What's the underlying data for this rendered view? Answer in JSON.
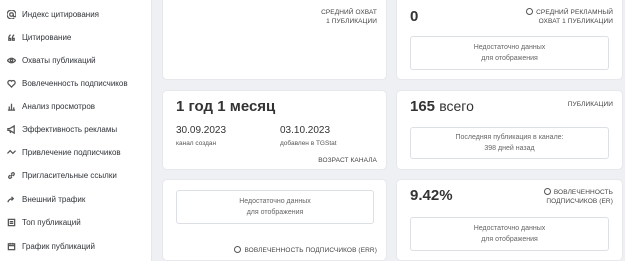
{
  "sidebar": {
    "items": [
      {
        "label": "Индекс цитирования",
        "icon": "at-icon"
      },
      {
        "label": "Цитирование",
        "icon": "quote-icon"
      },
      {
        "label": "Охваты публикаций",
        "icon": "eye-icon"
      },
      {
        "label": "Вовлеченность подписчиков",
        "icon": "heart-icon"
      },
      {
        "label": "Анализ просмотров",
        "icon": "bar-chart-icon"
      },
      {
        "label": "Эффективность рекламы",
        "icon": "megaphone-icon"
      },
      {
        "label": "Привлечение подписчиков",
        "icon": "trend-icon"
      },
      {
        "label": "Пригласительные ссылки",
        "icon": "link-icon"
      },
      {
        "label": "Внешний трафик",
        "icon": "share-icon"
      },
      {
        "label": "Топ публикаций",
        "icon": "list-icon"
      },
      {
        "label": "График публикаций",
        "icon": "calendar-icon"
      }
    ]
  },
  "cards": {
    "reach": {
      "label_line1": "СРЕДНИЙ ОХВАТ",
      "label_line2": "1 ПУБЛИКАЦИИ"
    },
    "ad_reach": {
      "value": "0",
      "label_line1": "СРЕДНИЙ РЕКЛАМНЫЙ",
      "label_line2": "ОХВАТ 1 ПУБЛИКАЦИИ",
      "empty_line1": "Недостаточно данных",
      "empty_line2": "для отображения"
    },
    "age": {
      "value": "1 год 1 месяц",
      "created_date": "30.09.2023",
      "created_label": "канал создан",
      "added_date": "03.10.2023",
      "added_label": "добавлен в TGStat",
      "footer": "ВОЗРАСТ КАНАЛА"
    },
    "posts": {
      "value": "165",
      "unit": "всего",
      "label": "ПУБЛИКАЦИИ",
      "last_line1": "Последняя публикация в канале:",
      "last_line2": "398 дней назад"
    },
    "err": {
      "empty_line1": "Недостаточно данных",
      "empty_line2": "для отображения",
      "footer": "ВОВЛЕЧЕННОСТЬ ПОДПИСЧИКОВ (ERR)"
    },
    "er": {
      "value": "9.42%",
      "label_line1": "ВОВЛЕЧЕННОСТЬ",
      "label_line2": "ПОДПИСЧИКОВ (ER)",
      "empty_line1": "Недостаточно данных",
      "empty_line2": "для отображения"
    }
  }
}
